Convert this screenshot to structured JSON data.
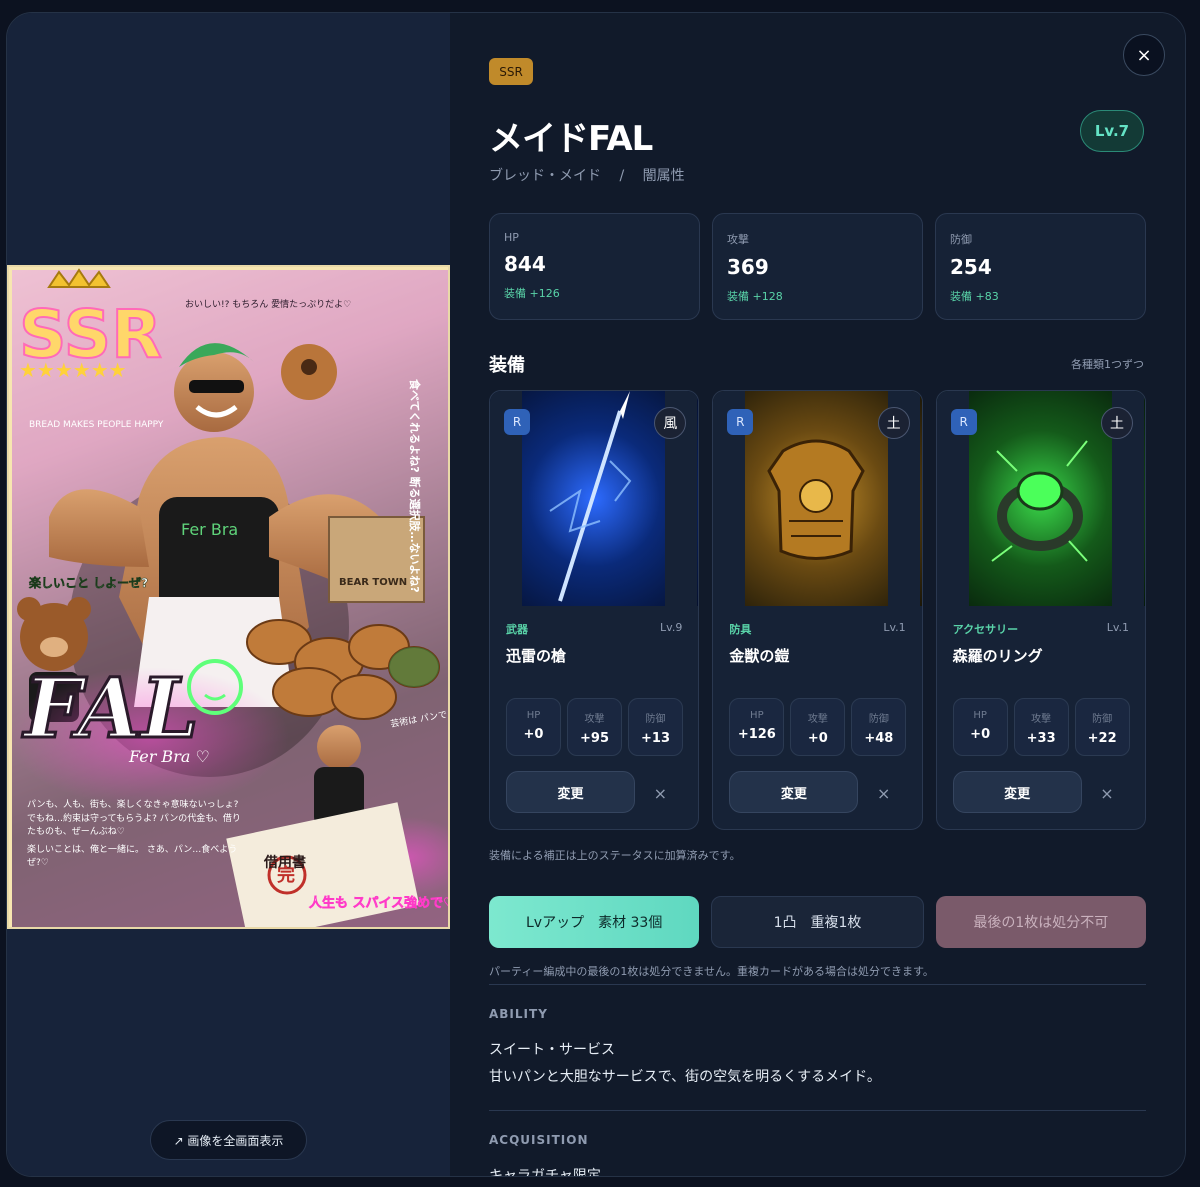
{
  "card": {
    "rarity": "SSR",
    "name": "メイドFAL",
    "class": "ブレッド・メイド",
    "separator": "/",
    "attribute": "闇属性",
    "level": "Lv.7",
    "art_text": {
      "logo": "SSR",
      "stars": "★★★★★★",
      "title": "FAL",
      "sign": "Fer Bra ♡",
      "shirt": "Fer Bra",
      "bubble_1": "おいしい!? もちろん 愛情たっぷりだよ♡",
      "bubble_2": "食べてくれるよね? 断る選択肢…ないよね?",
      "bubble_3": "楽しいこと しよーぜ?",
      "bubble_4": "芸術は パンで いけるよね?",
      "chalkboard": "BREAD MAKES PEOPLE HAPPY",
      "box": "BEAR TOWN",
      "stamp_title": "借用書",
      "stamp_mark": "完",
      "spice": "人生も スパイス強めで♡",
      "quote_1": "パンも、人も、街も、楽しくなきゃ意味ないっしょ? でもね…約束は守ってもらうよ? パンの代金も、借りたものも、ぜーんぶね♡",
      "quote_2": "楽しいことは、俺と一緒に。 さあ、パン…食べようぜ?♡"
    }
  },
  "fullscreen_label": "↗ 画像を全画面表示",
  "close_label": "×",
  "stats": [
    {
      "label": "HP",
      "value": "844",
      "bonus": "装備 +126"
    },
    {
      "label": "攻撃",
      "value": "369",
      "bonus": "装備 +128"
    },
    {
      "label": "防御",
      "value": "254",
      "bonus": "装備 +83"
    }
  ],
  "equipment": {
    "title": "装備",
    "hint": "各種類1つずつ",
    "note": "装備による補正は上のステータスに加算済みです。",
    "items": [
      {
        "rarity": "R",
        "element": "風",
        "type": "武器",
        "level": "Lv.9",
        "name": "迅雷の槍",
        "stats": [
          {
            "label": "HP",
            "value": "+0"
          },
          {
            "label": "攻撃",
            "value": "+95"
          },
          {
            "label": "防御",
            "value": "+13"
          }
        ],
        "change": "変更",
        "remove": "×"
      },
      {
        "rarity": "R",
        "element": "土",
        "type": "防具",
        "level": "Lv.1",
        "name": "金獣の鎧",
        "stats": [
          {
            "label": "HP",
            "value": "+126"
          },
          {
            "label": "攻撃",
            "value": "+0"
          },
          {
            "label": "防御",
            "value": "+48"
          }
        ],
        "change": "変更",
        "remove": "×"
      },
      {
        "rarity": "R",
        "element": "土",
        "type": "アクセサリー",
        "level": "Lv.1",
        "name": "森羅のリング",
        "stats": [
          {
            "label": "HP",
            "value": "+0"
          },
          {
            "label": "攻撃",
            "value": "+33"
          },
          {
            "label": "防御",
            "value": "+22"
          }
        ],
        "change": "変更",
        "remove": "×"
      }
    ]
  },
  "actions": {
    "level_up": "Lvアップ　素材 33個",
    "duplicate": "1凸　重複1枚",
    "discard": "最後の1枚は処分不可",
    "note": "パーティー編成中の最後の1枚は処分できません。重複カードがある場合は処分できます。"
  },
  "ability": {
    "heading": "ABILITY",
    "name": "スイート・サービス",
    "description": "甘いパンと大胆なサービスで、街の空気を明るくするメイド。"
  },
  "acquisition": {
    "heading": "ACQUISITION",
    "value": "キャラガチャ限定"
  },
  "colors": {
    "accent": "#64e3c5",
    "rarity_gold": "#c08a2a",
    "equip_rarity": "#2f62b8",
    "bonus_green": "#59d3a8"
  }
}
